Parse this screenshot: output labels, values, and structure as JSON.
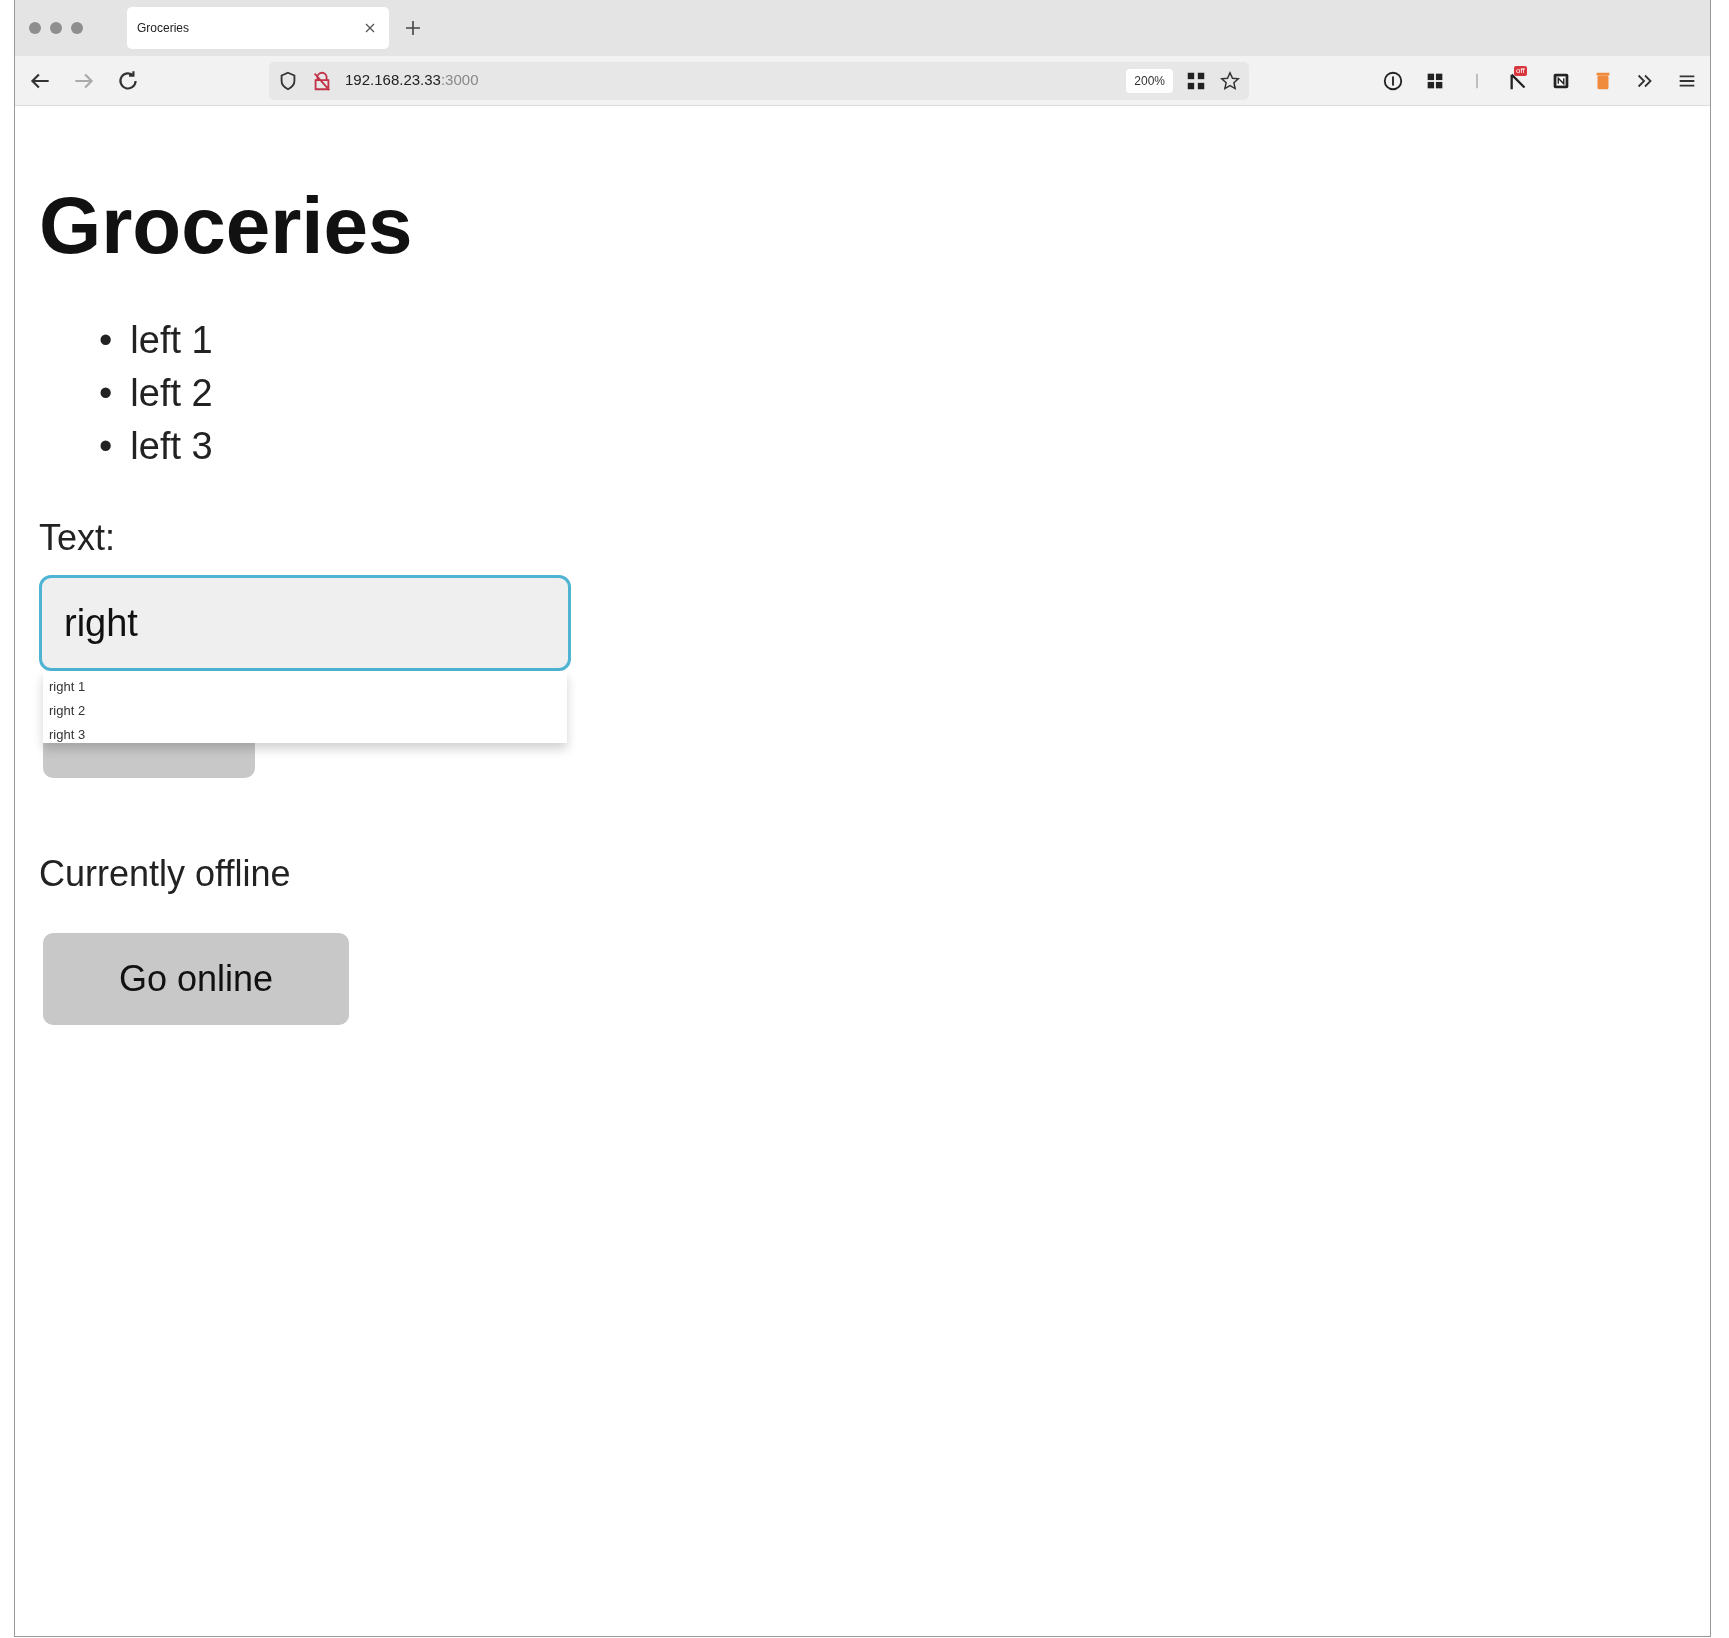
{
  "browser": {
    "tab": {
      "title": "Groceries",
      "selected": true
    },
    "address": {
      "host": "192.168.23.33",
      "port": ":3000"
    },
    "zoom": "200%",
    "extension_badge": "off"
  },
  "page": {
    "heading": "Groceries",
    "items": [
      {
        "bullet": "•",
        "text": "left 1"
      },
      {
        "bullet": "•",
        "text": "left 2"
      },
      {
        "bullet": "•",
        "text": "left 3"
      }
    ],
    "field": {
      "label": "Text:",
      "value": "right",
      "focused": true
    },
    "suggestions": [
      "right 1",
      "right 2",
      "right 3"
    ],
    "status": "Currently offline",
    "button": "Go online"
  }
}
